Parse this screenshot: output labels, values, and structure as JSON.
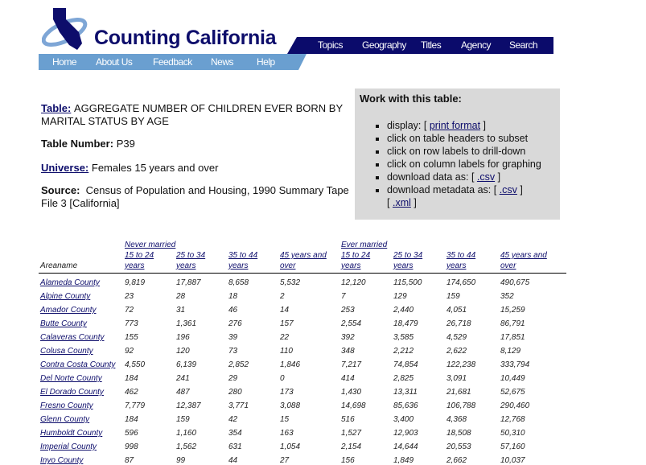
{
  "site": {
    "title": "Counting California"
  },
  "topnav": [
    "Topics",
    "Geography",
    "Titles",
    "Agency",
    "Search"
  ],
  "subnav": [
    "Home",
    "About Us",
    "Feedback",
    "News",
    "Help"
  ],
  "info": {
    "table_label": "Table:",
    "table_title": "AGGREGATE NUMBER OF CHILDREN EVER BORN BY MARITAL STATUS BY AGE",
    "number_label": "Table Number:",
    "number": "P39",
    "universe_label": "Universe:",
    "universe": "Females 15 years and over",
    "source_label": "Source:",
    "source": "Census of Population and Housing, 1990 Summary Tape File 3 [California]"
  },
  "work": {
    "heading": "Work with this table:",
    "display": "display: [",
    "print_format": "print format",
    "display_end": "]",
    "subset": "click on table headers to subset",
    "drill": "click on row labels to drill-down",
    "graph": "click on column labels for graphing",
    "download_data": "download data as: [",
    "csv": ".csv",
    "close": "]",
    "download_meta": "download metadata as: [",
    "meta_csv": ".csv",
    "xml": ".xml",
    "open": "["
  },
  "table": {
    "groups": [
      "Never married",
      "Ever married"
    ],
    "areaname": "Areaname",
    "columns": [
      "15 to 24 years",
      "25 to 34 years",
      "35 to 44 years",
      "45 years and over",
      "15 to 24 years",
      "25 to 34 years",
      "35 to 44 years",
      "45 years and over"
    ],
    "rows": [
      [
        "Alameda County",
        "9,819",
        "17,887",
        "8,658",
        "5,532",
        "12,120",
        "115,500",
        "174,650",
        "490,675"
      ],
      [
        "Alpine County",
        "23",
        "28",
        "18",
        "2",
        "7",
        "129",
        "159",
        "352"
      ],
      [
        "Amador County",
        "72",
        "31",
        "46",
        "14",
        "253",
        "2,440",
        "4,051",
        "15,259"
      ],
      [
        "Butte County",
        "773",
        "1,361",
        "276",
        "157",
        "2,554",
        "18,479",
        "26,718",
        "86,791"
      ],
      [
        "Calaveras County",
        "155",
        "196",
        "39",
        "22",
        "392",
        "3,585",
        "4,529",
        "17,851"
      ],
      [
        "Colusa County",
        "92",
        "120",
        "73",
        "110",
        "348",
        "2,212",
        "2,622",
        "8,129"
      ],
      [
        "Contra Costa County",
        "4,550",
        "6,139",
        "2,852",
        "1,846",
        "7,217",
        "74,854",
        "122,238",
        "333,794"
      ],
      [
        "Del Norte County",
        "184",
        "241",
        "29",
        "0",
        "414",
        "2,825",
        "3,091",
        "10,449"
      ],
      [
        "El Dorado County",
        "462",
        "487",
        "280",
        "173",
        "1,430",
        "13,311",
        "21,681",
        "52,675"
      ],
      [
        "Fresno County",
        "7,779",
        "12,387",
        "3,771",
        "3,088",
        "14,698",
        "85,636",
        "106,788",
        "290,460"
      ],
      [
        "Glenn County",
        "184",
        "159",
        "42",
        "15",
        "516",
        "3,400",
        "4,368",
        "12,768"
      ],
      [
        "Humboldt County",
        "596",
        "1,160",
        "354",
        "163",
        "1,527",
        "12,903",
        "18,508",
        "50,310"
      ],
      [
        "Imperial County",
        "998",
        "1,562",
        "631",
        "1,054",
        "2,154",
        "14,644",
        "20,553",
        "57,160"
      ],
      [
        "Inyo County",
        "87",
        "99",
        "44",
        "27",
        "156",
        "1,849",
        "2,662",
        "10,037"
      ]
    ]
  }
}
